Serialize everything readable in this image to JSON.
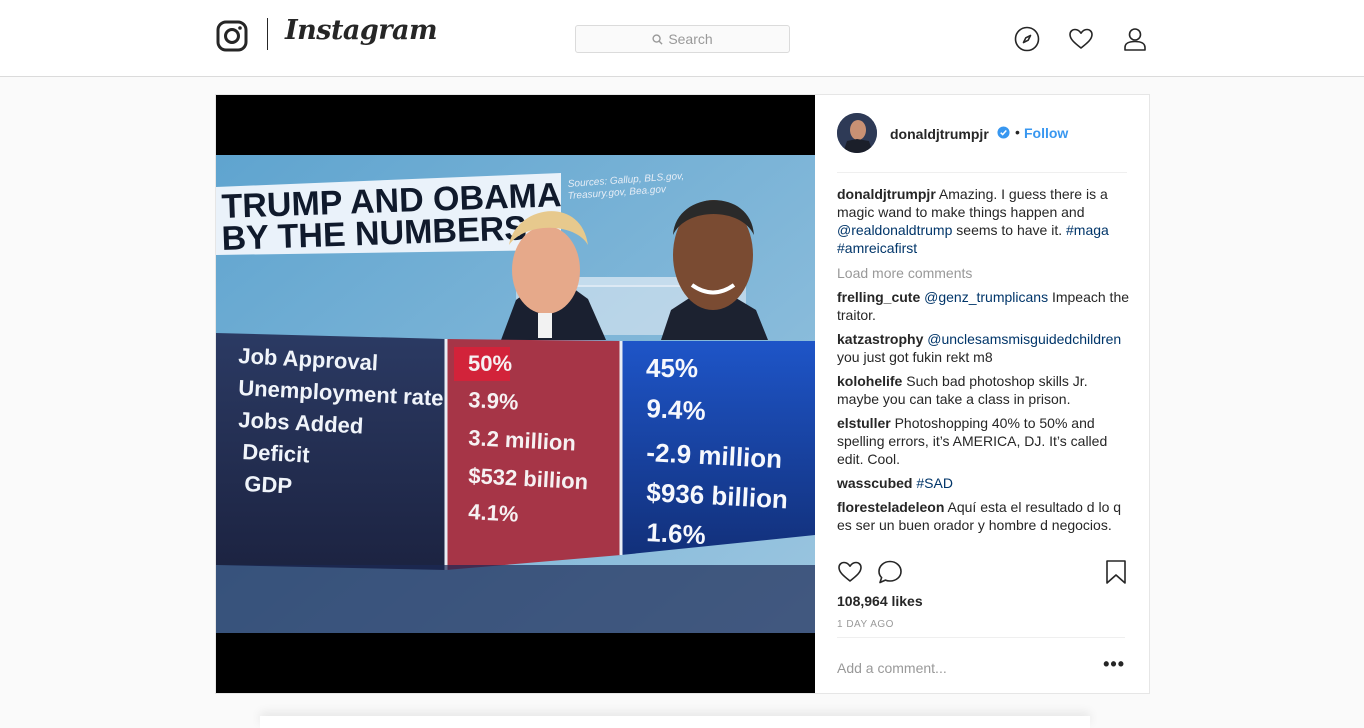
{
  "header": {
    "wordmark": "Instagram",
    "search_placeholder": "Search"
  },
  "post": {
    "username": "donaldjtrumpjr",
    "follow_label": "Follow",
    "likes": "108,964 likes",
    "time_ago": "1 DAY AGO",
    "add_comment_placeholder": "Add a comment...",
    "more": "•••",
    "load_more": "Load more comments",
    "caption": {
      "user": "donaldjtrumpjr",
      "text1": "Amazing. I guess there is a magic wand to make things happen and ",
      "mention": "@realdonaldtrump",
      "text2": " seems to have it. ",
      "tag1": "#maga",
      "tag2": "#amreicafirst"
    },
    "comments": [
      {
        "user": "frelling_cute",
        "mention": "@genz_trumplicans",
        "text": " Impeach the traitor."
      },
      {
        "user": "katzastrophy",
        "mention": "@unclesamsmisguidedchildren",
        "text": " you just got fukin rekt m8"
      },
      {
        "user": "kolohelife",
        "mention": "",
        "text": "Such bad photoshop skills Jr. maybe you can take a class in prison."
      },
      {
        "user": "elstuller",
        "mention": "",
        "text": "Photoshopping 40% to 50% and spelling errors, it’s AMERICA, DJ. It’s called edit. Cool."
      },
      {
        "user": "wasscubed",
        "mention": "#SAD",
        "text": ""
      },
      {
        "user": "floresteladeleon",
        "mention": "",
        "text": "Aquí esta el resultado d lo q es ser un buen orador y hombre d negocios."
      }
    ]
  },
  "image": {
    "title_line1": "TRUMP AND OBAMA",
    "title_line2": "BY THE NUMBERS",
    "sources_line1": "Sources: Gallup, BLS.gov,",
    "sources_line2": "Treasury.gov, Bea.gov",
    "rows": [
      "Job Approval",
      "Unemployment rate",
      "Jobs Added",
      "Deficit",
      "GDP"
    ],
    "trump_values": [
      "50%",
      "3.9%",
      "3.2 million",
      "$532 billion",
      "4.1%"
    ],
    "obama_values": [
      "45%",
      "9.4%",
      "-2.9 million",
      "$936 billion",
      "1.6%"
    ]
  },
  "colors": {
    "link_blue": "#3897f0",
    "mention_navy": "#003569",
    "muted": "#999999",
    "border": "#dbdbdb"
  }
}
